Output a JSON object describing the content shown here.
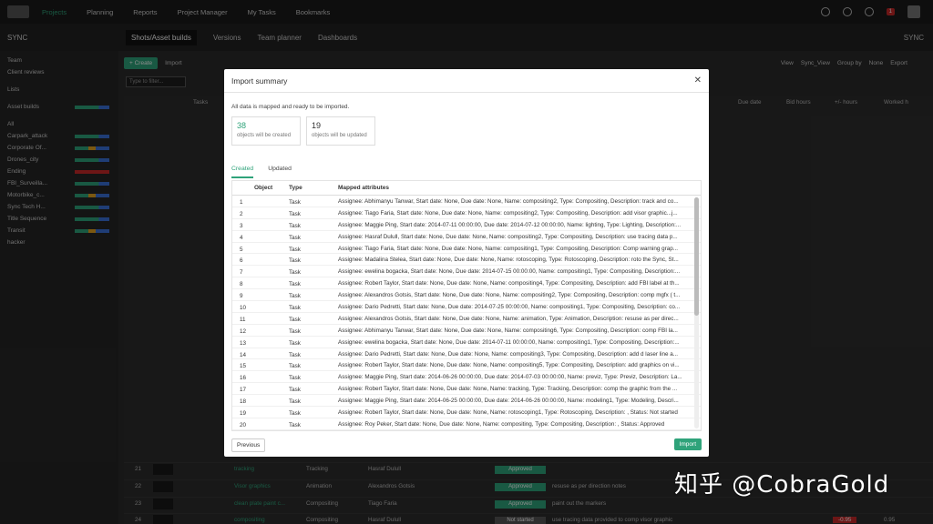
{
  "nav": {
    "items": [
      "Projects",
      "Planning",
      "Reports",
      "Project Manager",
      "My Tasks",
      "Bookmarks"
    ],
    "active_index": 0,
    "notif_count": "1"
  },
  "subnav": {
    "project": "SYNC",
    "tabs": [
      "Shots/Asset builds",
      "Versions",
      "Team planner",
      "Dashboards"
    ],
    "right": "SYNC"
  },
  "sidebar": {
    "items": [
      {
        "label": "Team"
      },
      {
        "label": "Client reviews"
      },
      {
        "label": "Lists"
      },
      {
        "label": "Asset builds"
      },
      {
        "label": "All"
      },
      {
        "label": "Carpark_attack"
      },
      {
        "label": "Corporate Of..."
      },
      {
        "label": "Drones_city"
      },
      {
        "label": "Ending"
      },
      {
        "label": "FBI_Surveilla..."
      },
      {
        "label": "Motorbike_c..."
      },
      {
        "label": "Sync Tech H..."
      },
      {
        "label": "Title Sequence"
      },
      {
        "label": "Transit"
      },
      {
        "label": "hacker"
      }
    ]
  },
  "toolbar": {
    "create": "+ Create",
    "import": "Import",
    "view_label": "View",
    "view_value": "Sync_View",
    "group_label": "Group by",
    "group_value": "None",
    "export": "Export",
    "filter_placeholder": "Type to filter..."
  },
  "grid": {
    "headers": [
      "Tasks",
      "Due date",
      "Bid hours",
      "+/- hours",
      "Worked h"
    ],
    "rows": [
      {
        "num": "21",
        "name": "tracking",
        "type": "Tracking",
        "assignee": "Hasraf Dulull",
        "status": "Approved",
        "desc": "",
        "bid": "",
        "diff": "",
        "worked": ""
      },
      {
        "num": "22",
        "name": "Visor graphics",
        "type": "Animation",
        "assignee": "Alexandros Gotsis",
        "status": "Approved",
        "desc": "resuse as per direction notes",
        "bid": "",
        "diff": "",
        "worked": ""
      },
      {
        "num": "23",
        "name": "clean plate paint c...",
        "type": "Compositing",
        "assignee": "Tiago Faria",
        "status": "Approved",
        "desc": "paint out the markers",
        "bid": "",
        "diff": "",
        "worked": ""
      },
      {
        "num": "24",
        "name": "compositing",
        "type": "Compositing",
        "assignee": "Hasraf Dulull",
        "status": "Not started",
        "desc": "use tracing data provided to comp visor graphic",
        "bid": "",
        "diff": "-0.95",
        "worked": "0.95"
      }
    ]
  },
  "modal": {
    "title": "Import summary",
    "message": "All data is mapped and ready to be imported.",
    "created_count": "38",
    "created_label": "objects will be created",
    "updated_count": "19",
    "updated_label": "objects will be updated",
    "tabs": [
      "Created",
      "Updated"
    ],
    "columns": [
      "Object",
      "Type",
      "Mapped attributes"
    ],
    "rows": [
      {
        "n": "1",
        "type": "Task",
        "attrs": "Assignee: Abhimanyu Tanwar, Start date: None, Due date: None, Name: compositing2, Type: Compositing, Description: track and co..."
      },
      {
        "n": "2",
        "type": "Task",
        "attrs": "Assignee: Tiago Faria, Start date: None, Due date: None, Name: compositing2, Type: Compositing, Description: add visor graphic...j..."
      },
      {
        "n": "3",
        "type": "Task",
        "attrs": "Assignee: Maggie Ping, Start date: 2014-07-11 00:00:00, Due date: 2014-07-12 00:00:00, Name: lighting, Type: Lighting, Description:..."
      },
      {
        "n": "4",
        "type": "Task",
        "attrs": "Assignee: Hasraf Dulull, Start date: None, Due date: None, Name: compositing2, Type: Compositing, Description: use tracing data p..."
      },
      {
        "n": "5",
        "type": "Task",
        "attrs": "Assignee: Tiago Faria, Start date: None, Due date: None, Name: compositing1, Type: Compositing, Description: Comp warning grap..."
      },
      {
        "n": "6",
        "type": "Task",
        "attrs": "Assignee: Madalina Stelea, Start date: None, Due date: None, Name: rotoscoping, Type: Rotoscoping, Description: roto the Sync, St..."
      },
      {
        "n": "7",
        "type": "Task",
        "attrs": "Assignee: ewelina bogacka, Start date: None, Due date: 2014-07-15 00:00:00, Name: compositing1, Type: Compositing, Description:..."
      },
      {
        "n": "8",
        "type": "Task",
        "attrs": "Assignee: Robert Taylor, Start date: None, Due date: None, Name: compositing4, Type: Compositing, Description: add FBI label at th..."
      },
      {
        "n": "9",
        "type": "Task",
        "attrs": "Assignee: Alexandros Gotsis, Start date: None, Due date: None, Name: compositing2, Type: Compositing, Description: comp mgfx ( t..."
      },
      {
        "n": "10",
        "type": "Task",
        "attrs": "Assignee: Dario Pedretti, Start date: None, Due date: 2014-07-25 00:00:00, Name: compositing1, Type: Compositing, Description: co..."
      },
      {
        "n": "11",
        "type": "Task",
        "attrs": "Assignee: Alexandros Gotsis, Start date: None, Due date: None, Name: animation, Type: Animation, Description: resuse as per direc..."
      },
      {
        "n": "12",
        "type": "Task",
        "attrs": "Assignee: Abhimanyu Tanwar, Start date: None, Due date: None, Name: compositing6, Type: Compositing, Description: comp FBI la..."
      },
      {
        "n": "13",
        "type": "Task",
        "attrs": "Assignee: ewelina bogacka, Start date: None, Due date: 2014-07-11 00:00:00, Name: compositing1, Type: Compositing, Description:..."
      },
      {
        "n": "14",
        "type": "Task",
        "attrs": "Assignee: Dario Pedretti, Start date: None, Due date: None, Name: compositing3, Type: Compositing, Description: add d laser line a..."
      },
      {
        "n": "15",
        "type": "Task",
        "attrs": "Assignee: Robert Taylor, Start date: None, Due date: None, Name: compositing5, Type: Compositing, Description: add graphics on vi..."
      },
      {
        "n": "16",
        "type": "Task",
        "attrs": "Assignee: Maggie Ping, Start date: 2014-06-26 00:00:00, Due date: 2014-07-03 00:00:00, Name: previz, Type: Previz, Description: La..."
      },
      {
        "n": "17",
        "type": "Task",
        "attrs": "Assignee: Robert Taylor, Start date: None, Due date: None, Name: tracking, Type: Tracking, Description: comp the graphic from the ..."
      },
      {
        "n": "18",
        "type": "Task",
        "attrs": "Assignee: Maggie Ping, Start date: 2014-06-25 00:00:00, Due date: 2014-06-26 00:00:00, Name: modeling1, Type: Modeling, Descri..."
      },
      {
        "n": "19",
        "type": "Task",
        "attrs": "Assignee: Robert Taylor, Start date: None, Due date: None, Name: rotoscoping1, Type: Rotoscoping, Description: , Status: Not started"
      },
      {
        "n": "20",
        "type": "Task",
        "attrs": "Assignee: Roy Peker, Start date: None, Due date: None, Name: compositing, Type: Compositing, Description: , Status: Approved"
      }
    ],
    "prev_label": "Previous",
    "import_label": "Import"
  },
  "watermark": "知乎 @CobraGold"
}
